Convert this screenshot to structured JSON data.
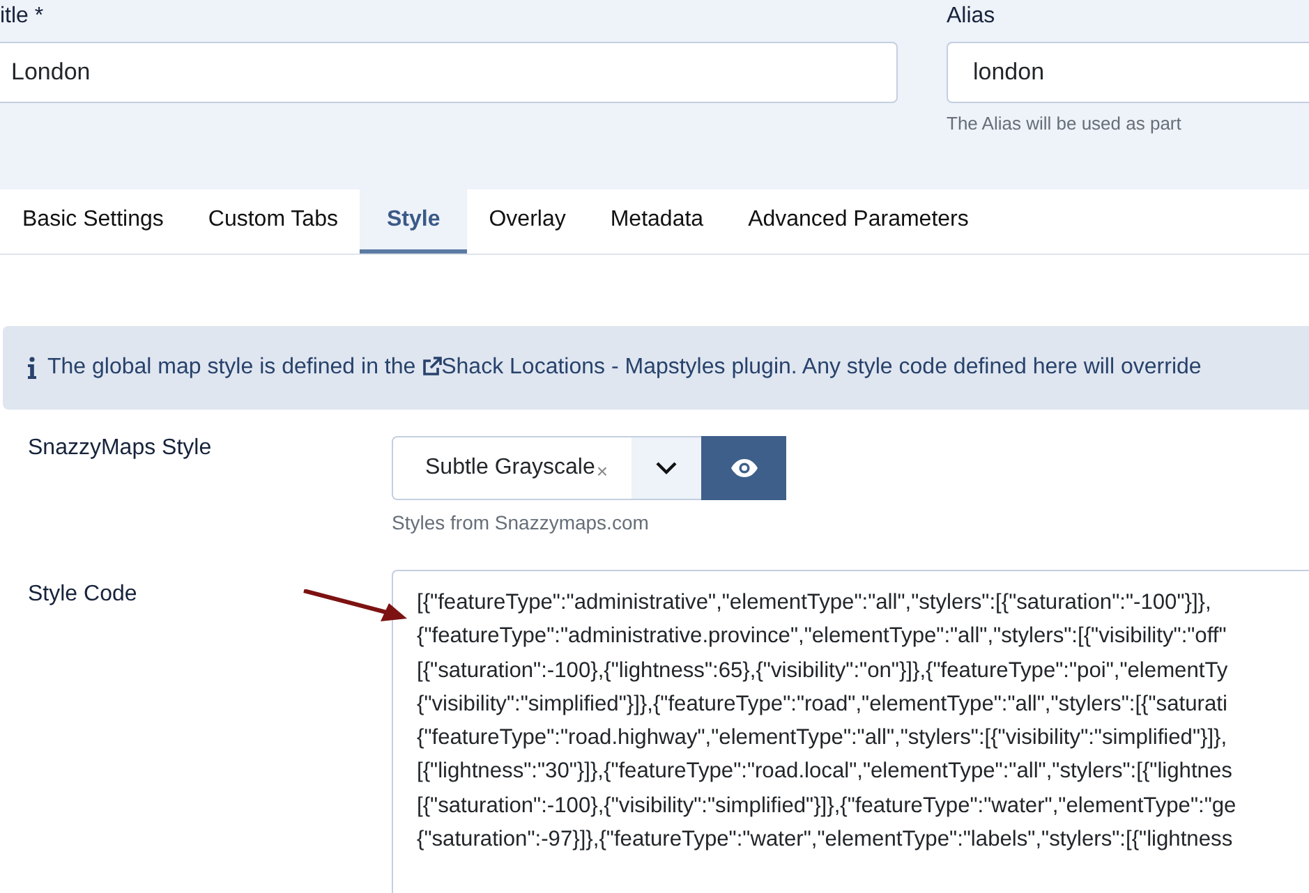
{
  "title_field": {
    "label": "itle *",
    "value": "London"
  },
  "alias_field": {
    "label": "Alias",
    "value": "london",
    "hint": "The Alias will be used as part"
  },
  "tabs": [
    {
      "label": "Basic Settings",
      "selected": false
    },
    {
      "label": "Custom Tabs",
      "selected": false
    },
    {
      "label": "Style",
      "selected": true
    },
    {
      "label": "Overlay",
      "selected": false
    },
    {
      "label": "Metadata",
      "selected": false
    },
    {
      "label": "Advanced Parameters",
      "selected": false
    }
  ],
  "info": {
    "before": "The global map style is defined in the",
    "link": "Shack Locations - Mapstyles plugin",
    "after": ". Any style code defined here will override"
  },
  "snazzy_style": {
    "label": "SnazzyMaps Style",
    "value": "Subtle Grayscale",
    "clear": "×",
    "hint": "Styles from Snazzymaps.com"
  },
  "style_code": {
    "label": "Style Code",
    "lines": [
      "[{\"featureType\":\"administrative\",\"elementType\":\"all\",\"stylers\":[{\"saturation\":\"-100\"}]},",
      "{\"featureType\":\"administrative.province\",\"elementType\":\"all\",\"stylers\":[{\"visibility\":\"off\"",
      "[{\"saturation\":-100},{\"lightness\":65},{\"visibility\":\"on\"}]},{\"featureType\":\"poi\",\"elementTy",
      "{\"visibility\":\"simplified\"}]},{\"featureType\":\"road\",\"elementType\":\"all\",\"stylers\":[{\"saturati",
      "{\"featureType\":\"road.highway\",\"elementType\":\"all\",\"stylers\":[{\"visibility\":\"simplified\"}]},",
      "[{\"lightness\":\"30\"}]},{\"featureType\":\"road.local\",\"elementType\":\"all\",\"stylers\":[{\"lightnes",
      "[{\"saturation\":-100},{\"visibility\":\"simplified\"}]},{\"featureType\":\"water\",\"elementType\":\"ge",
      "{\"saturation\":-97}]},{\"featureType\":\"water\",\"elementType\":\"labels\",\"stylers\":[{\"lightness"
    ]
  }
}
